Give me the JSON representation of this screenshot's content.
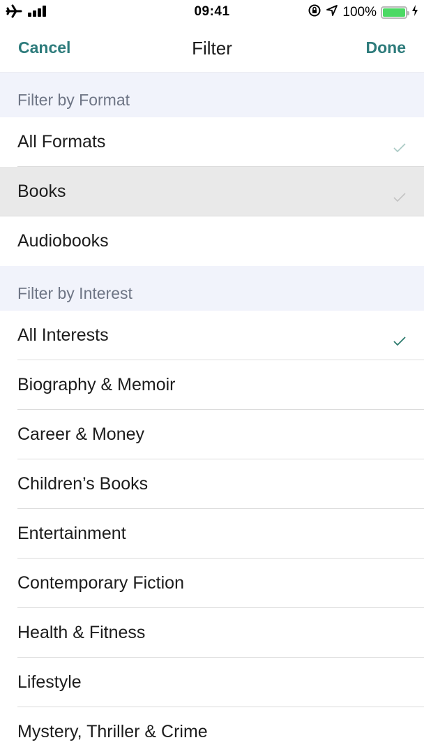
{
  "status_bar": {
    "time": "09:41",
    "battery_percent": "100%",
    "battery_level": 1.0,
    "icons": [
      "airplane-icon",
      "signal-icon",
      "orientation-lock-icon",
      "location-icon",
      "battery-icon",
      "charging-icon"
    ]
  },
  "nav": {
    "cancel_label": "Cancel",
    "title": "Filter",
    "done_label": "Done"
  },
  "colors": {
    "accent": "#2d7b7b",
    "section_bg": "#f1f3fb",
    "highlight_bg": "#e9e9e9",
    "battery": "#4cd964"
  },
  "format_section": {
    "header": "Filter by Format",
    "items": [
      {
        "label": "All Formats",
        "checked": true
      },
      {
        "label": "Books",
        "checked": true,
        "highlighted": true
      },
      {
        "label": "Audiobooks",
        "checked": false
      }
    ]
  },
  "interest_section": {
    "header": "Filter by Interest",
    "items": [
      {
        "label": "All Interests",
        "checked": true
      },
      {
        "label": "Biography & Memoir",
        "checked": false
      },
      {
        "label": "Career & Money",
        "checked": false
      },
      {
        "label": "Children’s Books",
        "checked": false
      },
      {
        "label": "Entertainment",
        "checked": false
      },
      {
        "label": "Contemporary Fiction",
        "checked": false
      },
      {
        "label": "Health & Fitness",
        "checked": false
      },
      {
        "label": "Lifestyle",
        "checked": false
      },
      {
        "label": "Mystery, Thriller & Crime",
        "checked": false
      }
    ]
  }
}
